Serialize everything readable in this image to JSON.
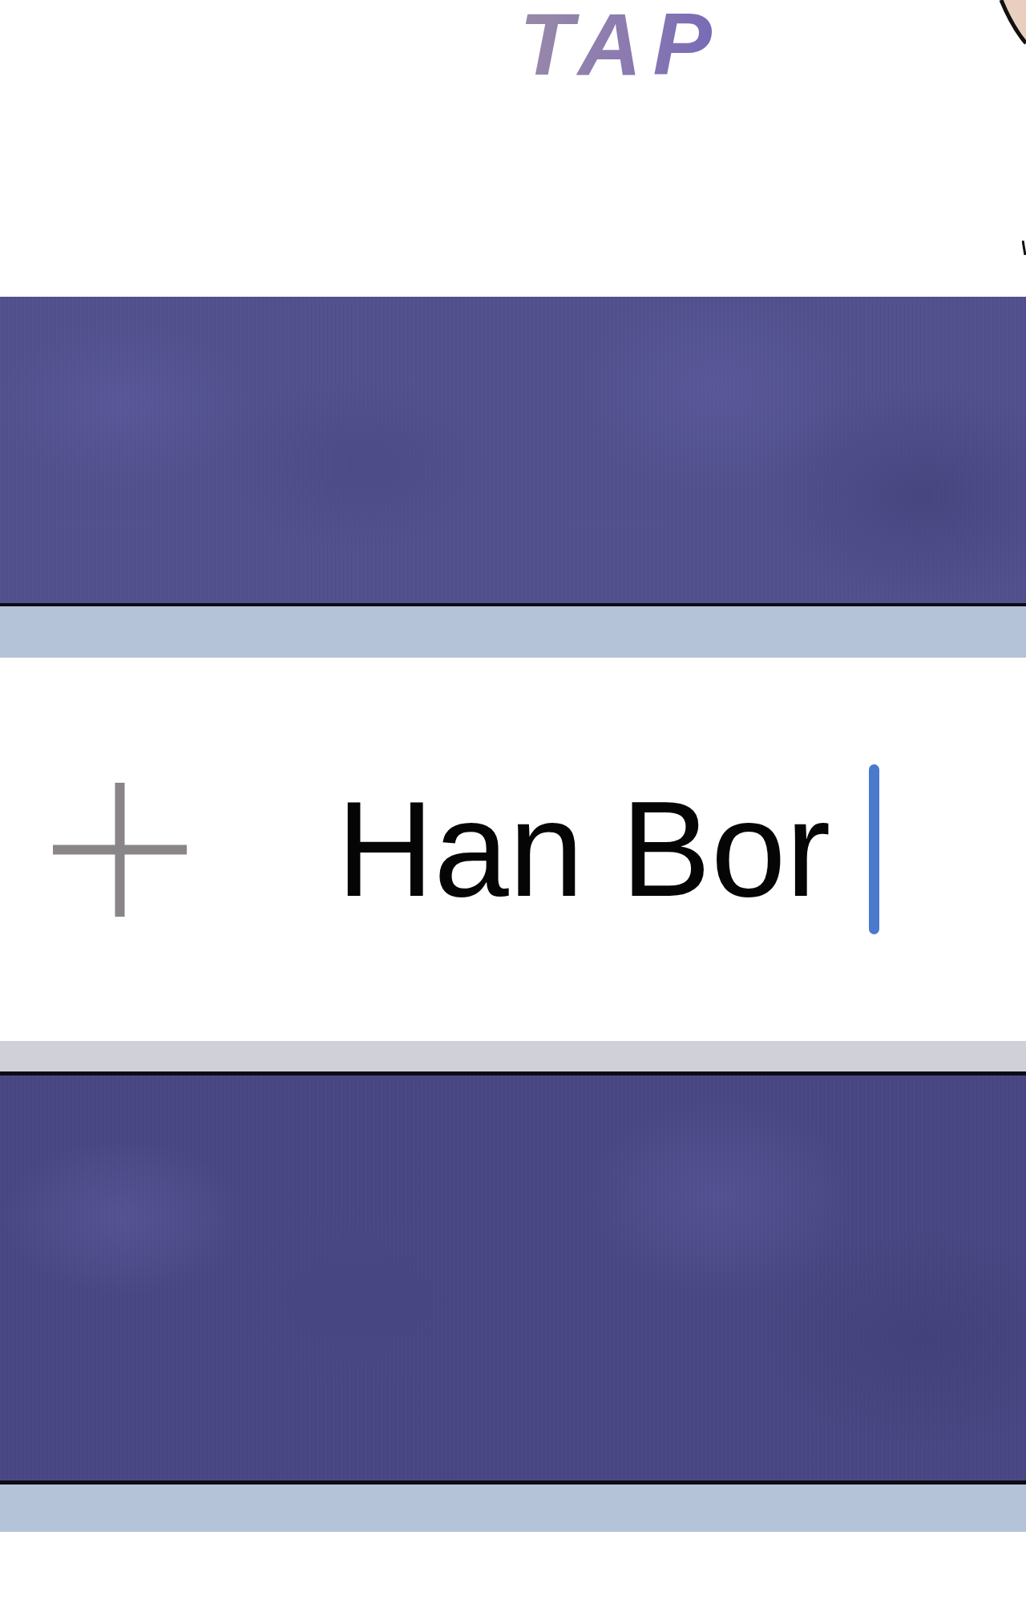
{
  "sound_effect": {
    "text": "TAP"
  },
  "input_bar": {
    "value": "Han Bor",
    "focused": true
  }
}
